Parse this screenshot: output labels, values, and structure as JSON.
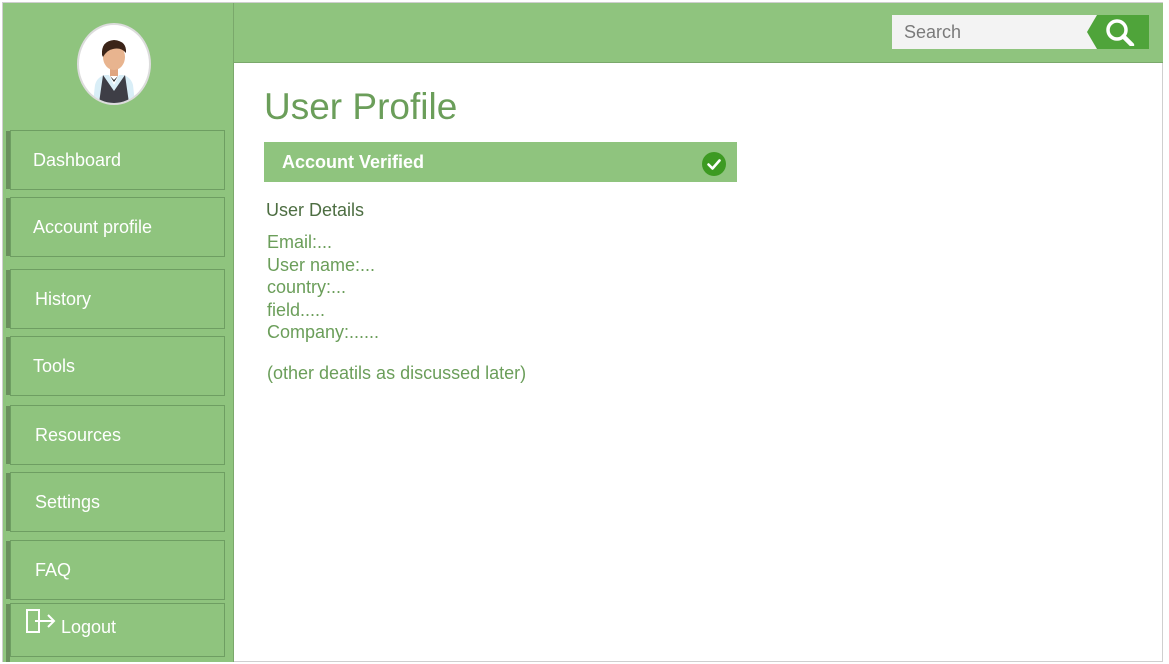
{
  "sidebar": {
    "items": [
      {
        "label": "Dashboard"
      },
      {
        "label": "Account profile"
      },
      {
        "label": "History"
      },
      {
        "label": "Tools"
      },
      {
        "label": "Resources"
      },
      {
        "label": "Settings"
      },
      {
        "label": "FAQ"
      },
      {
        "label": "Logout"
      }
    ]
  },
  "search": {
    "placeholder": "Search"
  },
  "main": {
    "title": "User Profile",
    "verified_label": "Account Verified",
    "details_heading": "User Details",
    "details": [
      "Email:...",
      "User name:...",
      "country:...",
      "field.....",
      "Company:......"
    ],
    "note": "(other deatils as discussed later)"
  },
  "colors": {
    "sidebar_bg": "#8fc47e",
    "accent": "#4fa43a",
    "title_text": "#6b9e5a"
  }
}
